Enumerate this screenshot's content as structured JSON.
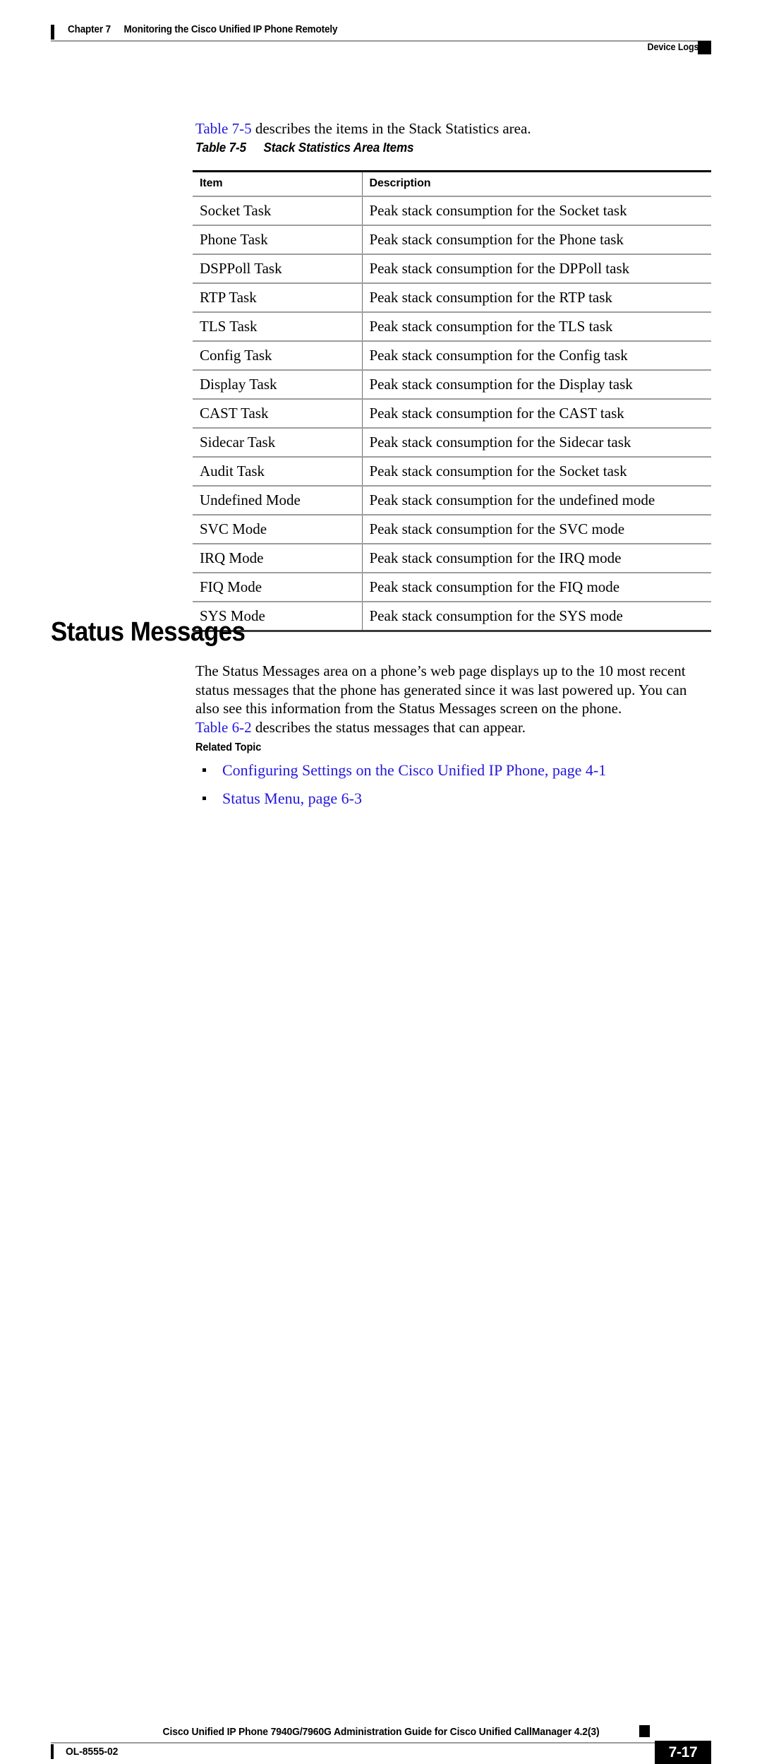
{
  "header": {
    "chapter_label": "Chapter 7",
    "chapter_title": "Monitoring the Cisco Unified IP Phone Remotely",
    "section_marker": "Device Logs"
  },
  "intro": {
    "link_text": "Table 7-5",
    "rest": " describes the items in the Stack Statistics area."
  },
  "table_caption": {
    "number": "Table 7-5",
    "title": "Stack Statistics Area Items"
  },
  "table": {
    "columns": [
      "Item",
      "Description"
    ],
    "rows": [
      [
        "Socket Task",
        "Peak stack consumption for the Socket task"
      ],
      [
        "Phone Task",
        "Peak stack consumption for the Phone task"
      ],
      [
        "DSPPoll Task",
        "Peak stack consumption for the DPPoll task"
      ],
      [
        "RTP Task",
        "Peak stack consumption for the RTP task"
      ],
      [
        "TLS Task",
        "Peak stack consumption for the TLS task"
      ],
      [
        "Config Task",
        "Peak stack consumption for the Config task"
      ],
      [
        "Display Task",
        "Peak stack consumption for the Display task"
      ],
      [
        "CAST Task",
        "Peak stack consumption for the CAST task"
      ],
      [
        "Sidecar Task",
        "Peak stack consumption for the Sidecar task"
      ],
      [
        "Audit Task",
        "Peak stack consumption for the Socket task"
      ],
      [
        "Undefined Mode",
        "Peak stack consumption for the undefined mode"
      ],
      [
        "SVC Mode",
        "Peak stack consumption for the SVC mode"
      ],
      [
        "IRQ Mode",
        "Peak stack consumption for the IRQ mode"
      ],
      [
        "FIQ Mode",
        "Peak stack consumption for the FIQ mode"
      ],
      [
        "SYS Mode",
        "Peak stack consumption for the SYS mode"
      ]
    ]
  },
  "section": {
    "heading": "Status Messages",
    "paragraph": "The Status Messages area on a phone’s web page displays up to the 10 most recent status messages that the phone has generated since it was last powered up. You can also see this information from the Status Messages screen on the phone.",
    "table_ref_link": "Table 6-2",
    "table_ref_rest": " describes the status messages that can appear."
  },
  "related": {
    "heading": "Related Topic",
    "links": [
      "Configuring Settings on the Cisco Unified IP Phone, page 4-1",
      "Status Menu, page 6-3"
    ]
  },
  "footer": {
    "guide_title": "Cisco Unified IP Phone 7940G/7960G Administration Guide for Cisco Unified CallManager 4.2(3)",
    "doc_id": "OL-8555-02",
    "page_number": "7-17"
  },
  "colors": {
    "link": "#2416dc",
    "rule": "#9a9a9a",
    "table_rule": "#9d9d9d",
    "text": "#000000"
  }
}
